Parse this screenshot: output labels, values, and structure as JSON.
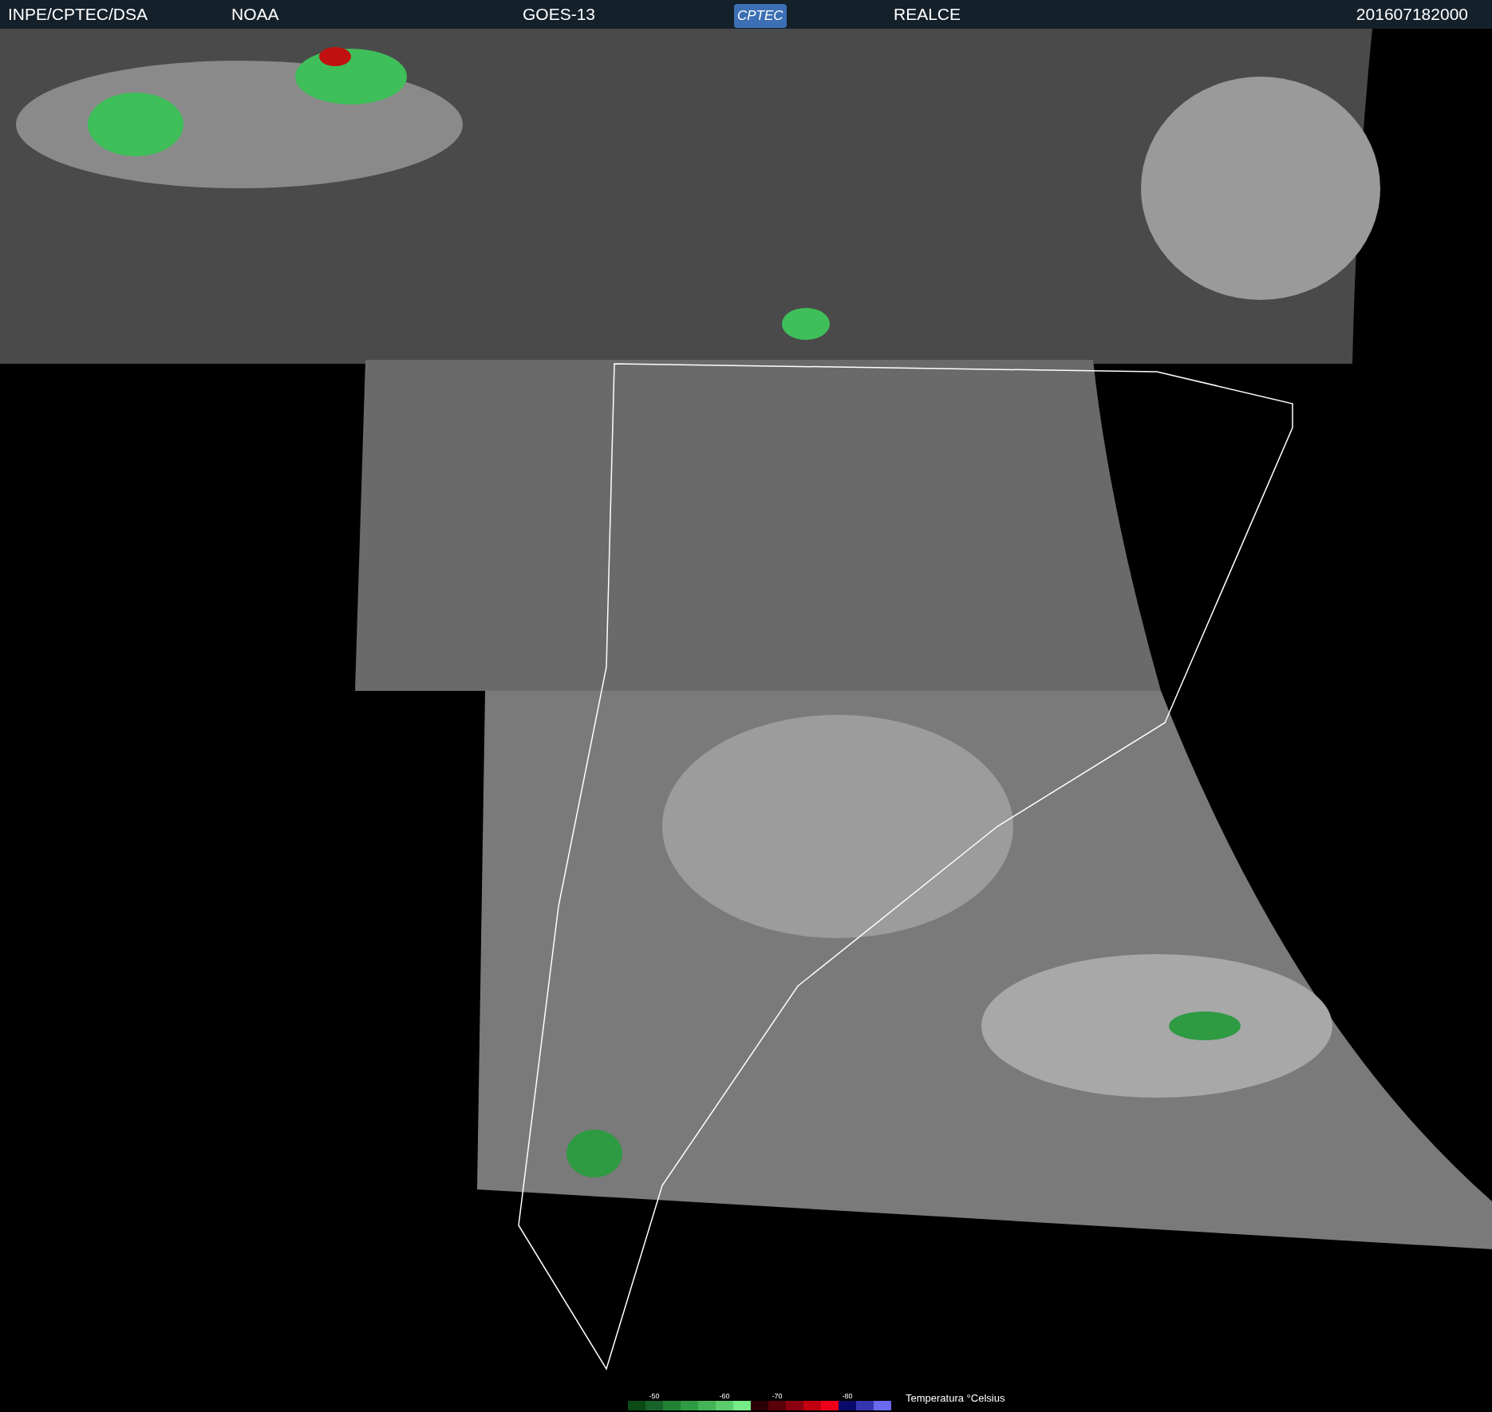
{
  "header": {
    "items": [
      {
        "kind": "text",
        "text": "INPE/CPTEC/DSA"
      },
      {
        "kind": "text",
        "text": "NOAA"
      },
      {
        "kind": "text",
        "text": "GOES-13"
      },
      {
        "kind": "logo",
        "text": "CPTEC"
      },
      {
        "kind": "text",
        "text": "REALCE"
      },
      {
        "kind": "text",
        "text": "201607182000"
      }
    ]
  },
  "legend": {
    "title": "Temperatura °Celsius",
    "swatches": [
      {
        "color": "#0a4a14"
      },
      {
        "color": "#17632a",
        "label": "-50"
      },
      {
        "color": "#228234"
      },
      {
        "color": "#2e9a42"
      },
      {
        "color": "#45b457"
      },
      {
        "color": "#5ccd6c",
        "label": "-60"
      },
      {
        "color": "#75ec85"
      },
      {
        "color": "#2a0006"
      },
      {
        "color": "#5a0008",
        "label": "-70"
      },
      {
        "color": "#8a0010"
      },
      {
        "color": "#c00010"
      },
      {
        "color": "#ee0018"
      },
      {
        "color": "#0a0a6a",
        "label": "-80"
      },
      {
        "color": "#3535b0"
      },
      {
        "color": "#6a6af0"
      }
    ]
  }
}
